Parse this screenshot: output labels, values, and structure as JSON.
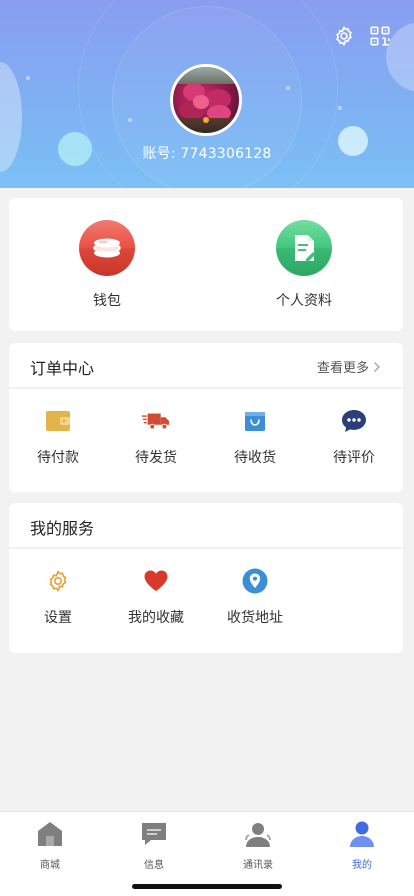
{
  "header": {
    "account_label": "账号: 7743306128",
    "icons": {
      "settings": "gear-icon",
      "qr": "qr-code-icon"
    }
  },
  "quick": {
    "items": [
      {
        "label": "钱包",
        "icon": "coins-icon",
        "color": "#e84c3d"
      },
      {
        "label": "个人资料",
        "icon": "document-icon",
        "color": "#3cc47b"
      }
    ]
  },
  "orders": {
    "title": "订单中心",
    "more_label": "查看更多",
    "items": [
      {
        "label": "待付款",
        "icon": "wallet-icon",
        "color": "#e2b44a"
      },
      {
        "label": "待发货",
        "icon": "truck-icon",
        "color": "#d24a31"
      },
      {
        "label": "待收货",
        "icon": "shopping-bag-icon",
        "color": "#3a8fd6"
      },
      {
        "label": "待评价",
        "icon": "chat-bubble-icon",
        "color": "#2a3f7a"
      }
    ]
  },
  "services": {
    "title": "我的服务",
    "items": [
      {
        "label": "设置",
        "icon": "gear-icon",
        "color": "#e1a23a"
      },
      {
        "label": "我的收藏",
        "icon": "heart-icon",
        "color": "#d8392a"
      },
      {
        "label": "收货地址",
        "icon": "location-pin-icon",
        "color": "#3a8fd6"
      }
    ]
  },
  "tabbar": {
    "items": [
      {
        "label": "商城",
        "icon": "home-icon",
        "active": false
      },
      {
        "label": "信息",
        "icon": "message-icon",
        "active": false
      },
      {
        "label": "通讯录",
        "icon": "contacts-icon",
        "active": false
      },
      {
        "label": "我的",
        "icon": "user-icon",
        "active": true
      }
    ],
    "active_color": "#3f6ae0"
  }
}
